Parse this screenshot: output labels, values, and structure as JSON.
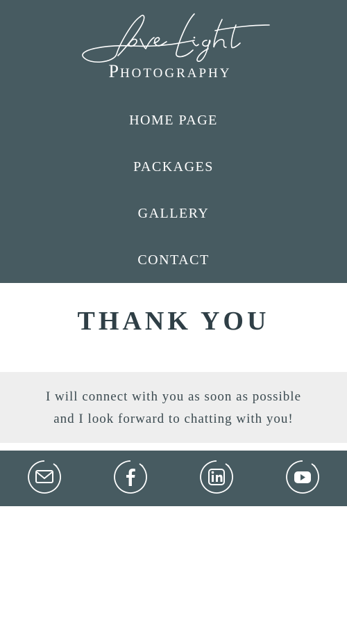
{
  "brand": {
    "script": "Love Light",
    "subtitle_first": "P",
    "subtitle_rest": "HOTOGRAPHY"
  },
  "nav": {
    "items": [
      {
        "label": "HOME PAGE"
      },
      {
        "label": "PACKAGES"
      },
      {
        "label": "GALLERY"
      },
      {
        "label": "CONTACT"
      }
    ]
  },
  "main": {
    "heading": "THANK YOU",
    "message_line1": "I will connect with you as soon as possible",
    "message_line2": "and I look forward to chatting with you!"
  },
  "social": {
    "icons": [
      "email-icon",
      "facebook-icon",
      "linkedin-icon",
      "youtube-icon"
    ]
  },
  "colors": {
    "header_bg": "#475b61",
    "message_bg": "#eeeeee",
    "text_dark": "#2f3f46",
    "white": "#ffffff"
  }
}
